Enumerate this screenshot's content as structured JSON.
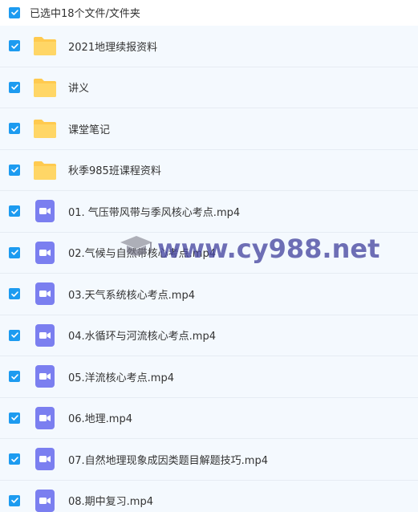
{
  "header": {
    "selection_label": "已选中18个文件/文件夹"
  },
  "items": [
    {
      "type": "folder",
      "name": "2021地理续报资料"
    },
    {
      "type": "folder",
      "name": "讲义"
    },
    {
      "type": "folder",
      "name": "课堂笔记"
    },
    {
      "type": "folder",
      "name": "秋季985班课程资料"
    },
    {
      "type": "video",
      "name": "01. 气压带风带与季风核心考点.mp4"
    },
    {
      "type": "video",
      "name": "02.气候与自然带核心考点.mp4"
    },
    {
      "type": "video",
      "name": "03.天气系统核心考点.mp4"
    },
    {
      "type": "video",
      "name": "04.水循环与河流核心考点.mp4"
    },
    {
      "type": "video",
      "name": "05.洋流核心考点.mp4"
    },
    {
      "type": "video",
      "name": "06.地理.mp4"
    },
    {
      "type": "video",
      "name": "07.自然地理现象成因类题目解题技巧.mp4"
    },
    {
      "type": "video",
      "name": "08.期中复习.mp4"
    }
  ],
  "watermark": {
    "text": "www.cy988.net"
  },
  "colors": {
    "checkbox": "#1d9bf0",
    "folder": "#ffca4f",
    "video": "#7b7ff0",
    "row_bg": "#f4f9fe"
  }
}
